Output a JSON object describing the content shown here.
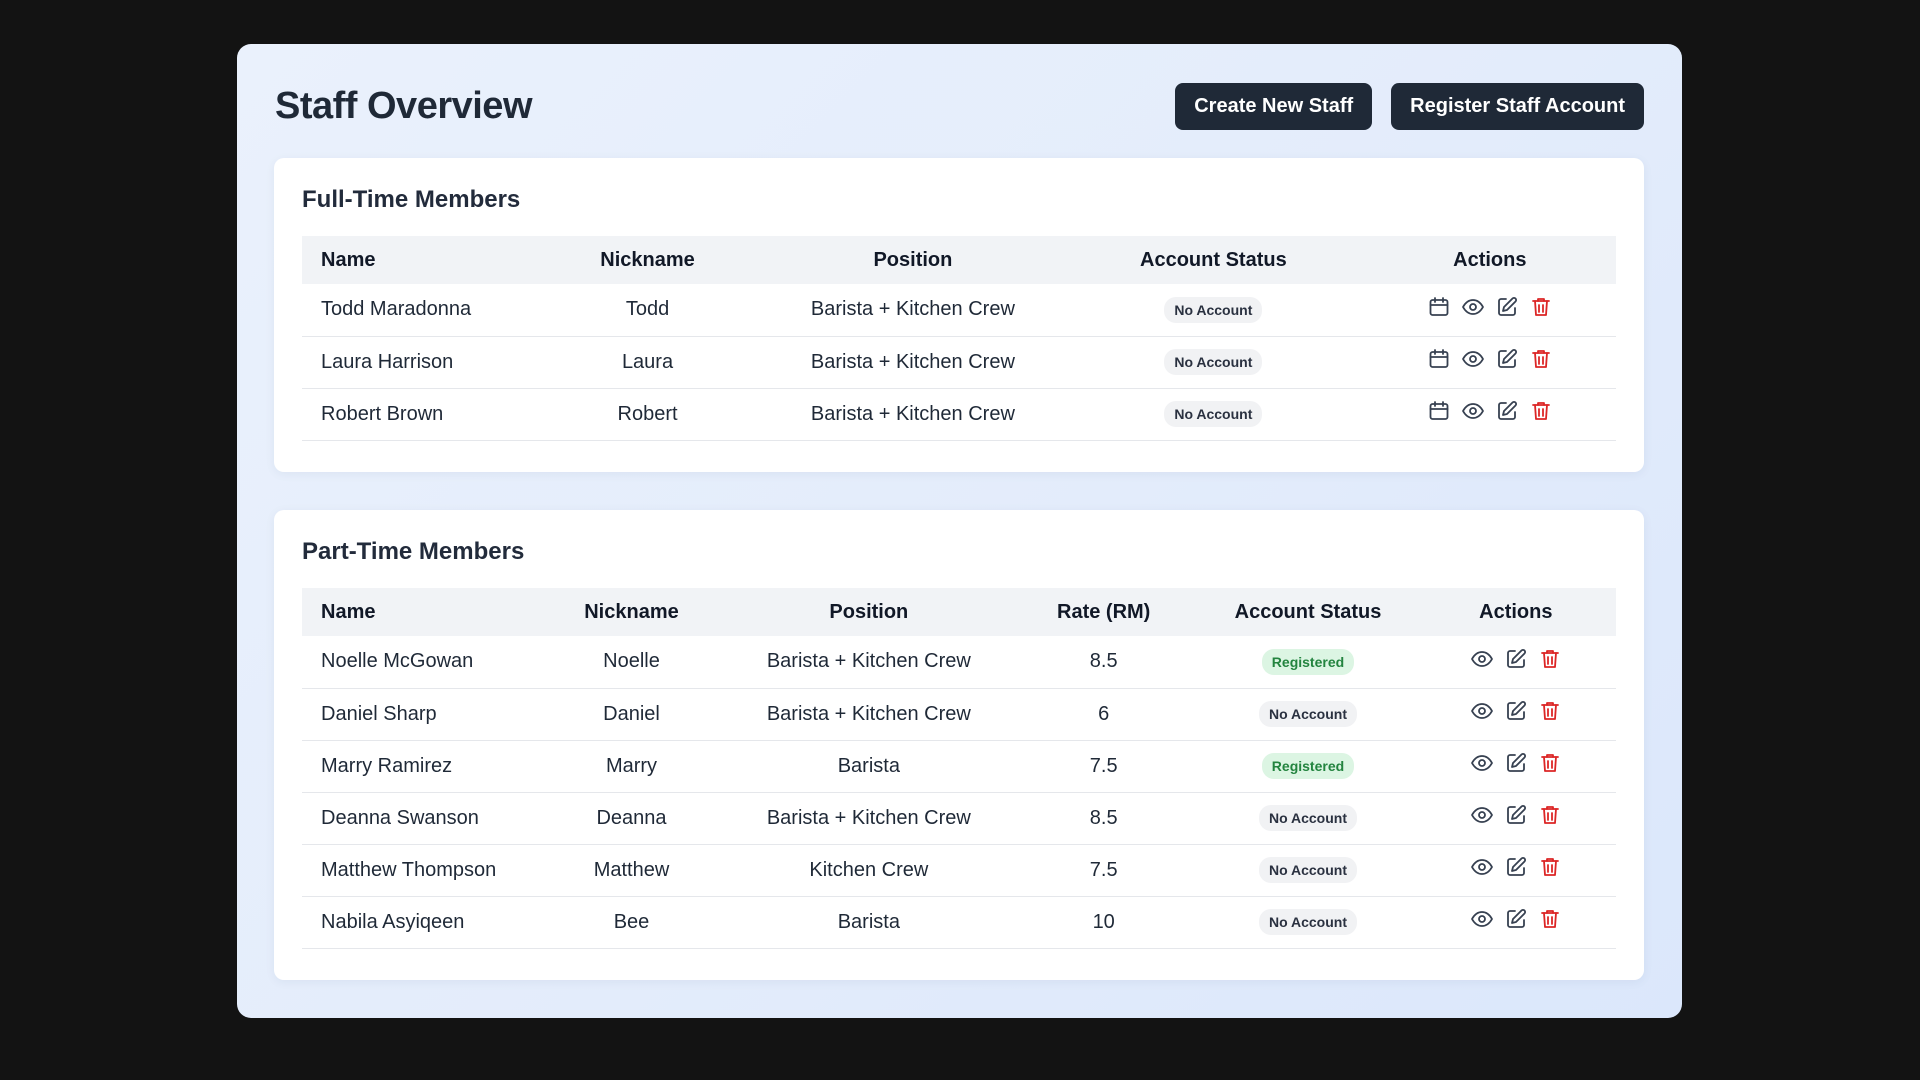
{
  "page": {
    "title": "Staff Overview",
    "buttons": {
      "create": "Create New Staff",
      "register": "Register Staff Account"
    }
  },
  "full_time": {
    "title": "Full-Time Members",
    "columns": {
      "name": "Name",
      "nickname": "Nickname",
      "position": "Position",
      "status": "Account Status",
      "actions": "Actions"
    },
    "rows": [
      {
        "name": "Todd Maradonna",
        "nickname": "Todd",
        "position": "Barista + Kitchen Crew",
        "status": "No Account",
        "status_type": "none"
      },
      {
        "name": "Laura Harrison",
        "nickname": "Laura",
        "position": "Barista + Kitchen Crew",
        "status": "No Account",
        "status_type": "none"
      },
      {
        "name": "Robert Brown",
        "nickname": "Robert",
        "position": "Barista + Kitchen Crew",
        "status": "No Account",
        "status_type": "none"
      }
    ]
  },
  "part_time": {
    "title": "Part-Time Members",
    "columns": {
      "name": "Name",
      "nickname": "Nickname",
      "position": "Position",
      "rate": "Rate (RM)",
      "status": "Account Status",
      "actions": "Actions"
    },
    "rows": [
      {
        "name": "Noelle McGowan",
        "nickname": "Noelle",
        "position": "Barista + Kitchen Crew",
        "rate": "8.5",
        "status": "Registered",
        "status_type": "reg"
      },
      {
        "name": "Daniel Sharp",
        "nickname": "Daniel",
        "position": "Barista + Kitchen Crew",
        "rate": "6",
        "status": "No Account",
        "status_type": "none"
      },
      {
        "name": "Marry Ramirez",
        "nickname": "Marry",
        "position": "Barista",
        "rate": "7.5",
        "status": "Registered",
        "status_type": "reg"
      },
      {
        "name": "Deanna Swanson",
        "nickname": "Deanna",
        "position": "Barista + Kitchen Crew",
        "rate": "8.5",
        "status": "No Account",
        "status_type": "none"
      },
      {
        "name": "Matthew Thompson",
        "nickname": "Matthew",
        "position": "Kitchen Crew",
        "rate": "7.5",
        "status": "No Account",
        "status_type": "none"
      },
      {
        "name": "Nabila Asyiqeen",
        "nickname": "Bee",
        "position": "Barista",
        "rate": "10",
        "status": "No Account",
        "status_type": "none"
      }
    ]
  },
  "icons": {
    "schedule": "calendar-icon",
    "view": "eye-icon",
    "edit": "edit-icon",
    "delete": "trash-icon"
  },
  "colors": {
    "button_bg": "#1f2937",
    "delete": "#dc2626",
    "registered_bg": "#dcf5e3",
    "registered_text": "#23843f",
    "no_account_bg": "#f1f2f4"
  }
}
